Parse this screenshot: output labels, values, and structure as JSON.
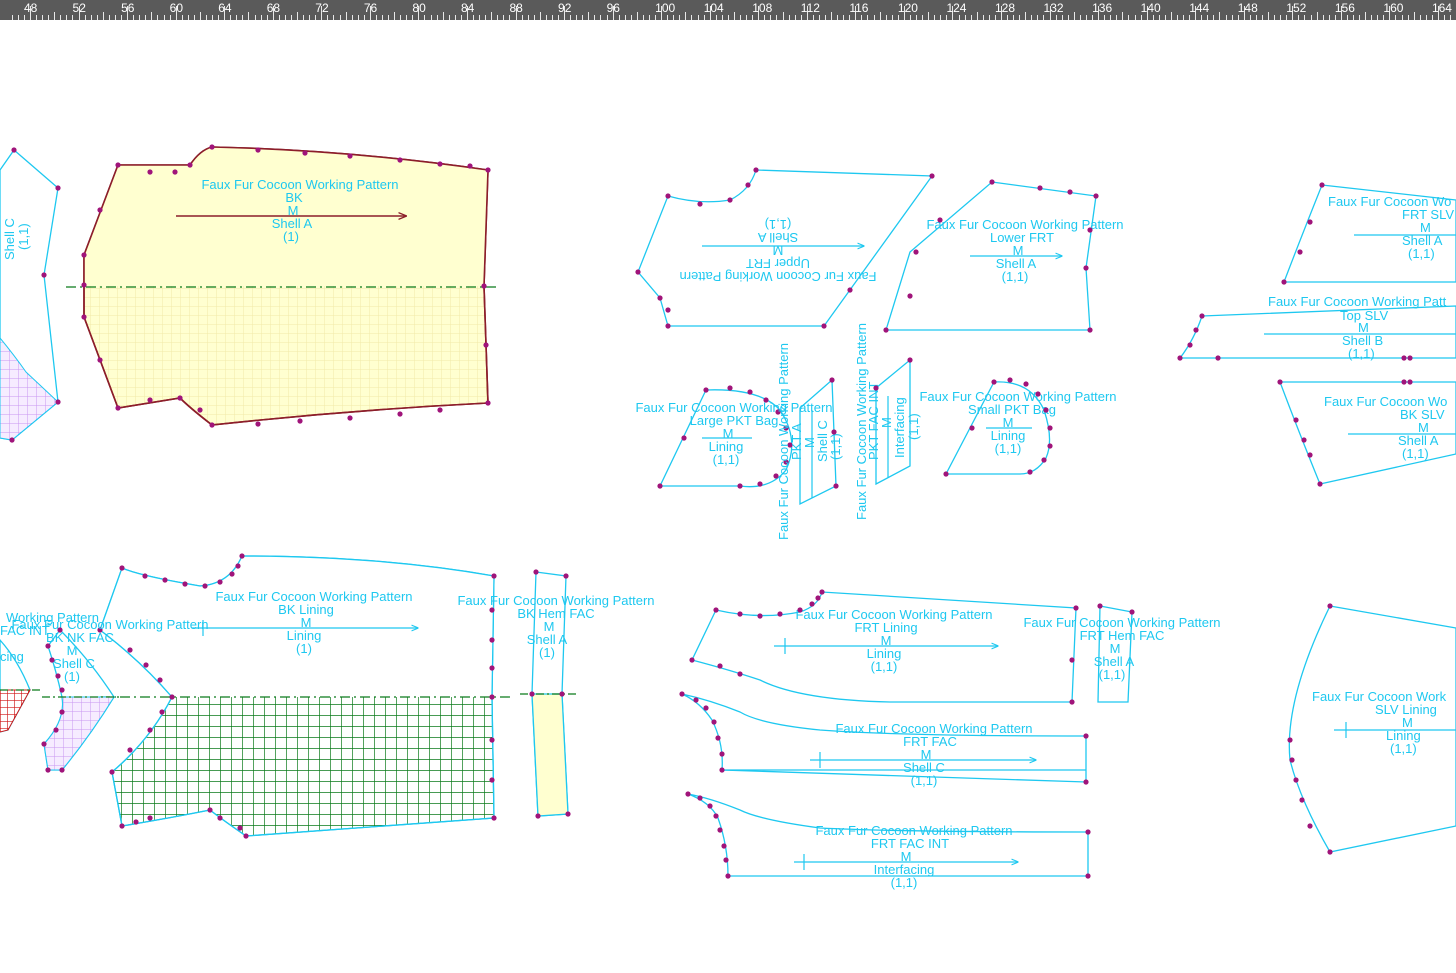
{
  "ruler": {
    "labels": [
      "48",
      "52",
      "56",
      "60",
      "64",
      "68",
      "72",
      "76",
      "80",
      "84",
      "88",
      "92",
      "96",
      "100",
      "104",
      "108",
      "112",
      "116",
      "120",
      "124",
      "128",
      "132",
      "136",
      "140",
      "144",
      "148",
      "152",
      "156",
      "160",
      "164"
    ]
  },
  "colors": {
    "ruler_bg": "#5a5a5a",
    "piece_line": "#1ec8f0",
    "active_piece_line": "#8c1e2a",
    "point": "#a0147a",
    "text": "#1ec8f0",
    "fill_yellow": "#ffffd0",
    "fill_green": "#0a7a1a",
    "fill_purple": "#c896f0",
    "fill_red": "#d01818"
  },
  "pieces": {
    "bk": {
      "l1": "Faux Fur Cocoon Working Pattern",
      "l2": "BK",
      "l3": "M",
      "l4": "Shell A",
      "l5": "(1)"
    },
    "left_top": {
      "l1": "Shell C",
      "l2": "(1,1)"
    },
    "upper_frt": {
      "l1": "Faux Fur Cocoon Working Pattern",
      "l2": "Upper FRT",
      "l3": "M",
      "l4": "Shell A",
      "l5": "(1,1)"
    },
    "lower_frt": {
      "l1": "Faux Fur Cocoon Working Pattern",
      "l2": "Lower FRT",
      "l3": "M",
      "l4": "Shell A",
      "l5": "(1,1)"
    },
    "frt_slv": {
      "l1": "Faux Fur Cocoon Wo",
      "l2": "FRT SLV",
      "l3": "M",
      "l4": "Shell A",
      "l5": "(1,1)"
    },
    "top_slv": {
      "l1": "Faux Fur Cocoon Working Patt",
      "l2": "Top SLV",
      "l3": "M",
      "l4": "Shell B",
      "l5": "(1,1)"
    },
    "bk_slv": {
      "l1": "Faux Fur Cocoon Wo",
      "l2": "BK SLV",
      "l3": "M",
      "l4": "Shell A",
      "l5": "(1,1)"
    },
    "large_pkt": {
      "l1": "Faux Fur Cocoon Working Pattern",
      "l2": "Large PKT Bag",
      "l3": "M",
      "l4": "Lining",
      "l5": "(1,1)"
    },
    "pkt_a": {
      "l1": "Faux Fur Cocoon Working Pattern",
      "l2": "PKT A",
      "l3": "M",
      "l4": "Shell C",
      "l5": "(1,1)"
    },
    "pkt_fac_int": {
      "l1": "Faux Fur Cocoon Working Pattern",
      "l2": "PKT FAC INT",
      "l3": "M",
      "l4": "Interfacing",
      "l5": "(1,1)"
    },
    "small_pkt": {
      "l1": "Faux Fur Cocoon Working Pattern",
      "l2": "Small PKT Bag",
      "l3": "M",
      "l4": "Lining",
      "l5": "(1,1)"
    },
    "bk_lining": {
      "l1": "Faux Fur Cocoon Working Pattern",
      "l2": "BK Lining",
      "l3": "M",
      "l4": "Lining",
      "l5": "(1)"
    },
    "bk_hem_fac": {
      "l1": "Faux Fur Cocoon Working Pattern",
      "l2": "BK Hem FAC",
      "l3": "M",
      "l4": "Shell A",
      "l5": "(1)"
    },
    "bk_nk_fac": {
      "l1": "Faux Fur Cocoon Working Pattern",
      "l2": "BK NK FAC",
      "l3": "M",
      "l4": "Shell C",
      "l5": "(1)"
    },
    "left_fac_int": {
      "l1": "Working Pattern",
      "l2": "FAC INT",
      "l3": "cing"
    },
    "frt_lining": {
      "l1": "Faux Fur Cocoon Working Pattern",
      "l2": "FRT Lining",
      "l3": "M",
      "l4": "Lining",
      "l5": "(1,1)"
    },
    "frt_hem_fac": {
      "l1": "Faux Fur Cocoon Working Pattern",
      "l2": "FRT Hem FAC",
      "l3": "M",
      "l4": "Shell A",
      "l5": "(1,1)"
    },
    "frt_fac": {
      "l1": "Faux Fur Cocoon Working Pattern",
      "l2": "FRT FAC",
      "l3": "M",
      "l4": "Shell C",
      "l5": "(1,1)"
    },
    "frt_fac_int": {
      "l1": "Faux Fur Cocoon Working Pattern",
      "l2": "FRT FAC INT",
      "l3": "M",
      "l4": "Interfacing",
      "l5": "(1,1)"
    },
    "slv_lining": {
      "l1": "Faux Fur Cocoon Work",
      "l2": "SLV Lining",
      "l3": "M",
      "l4": "Lining",
      "l5": "(1,1)"
    }
  }
}
